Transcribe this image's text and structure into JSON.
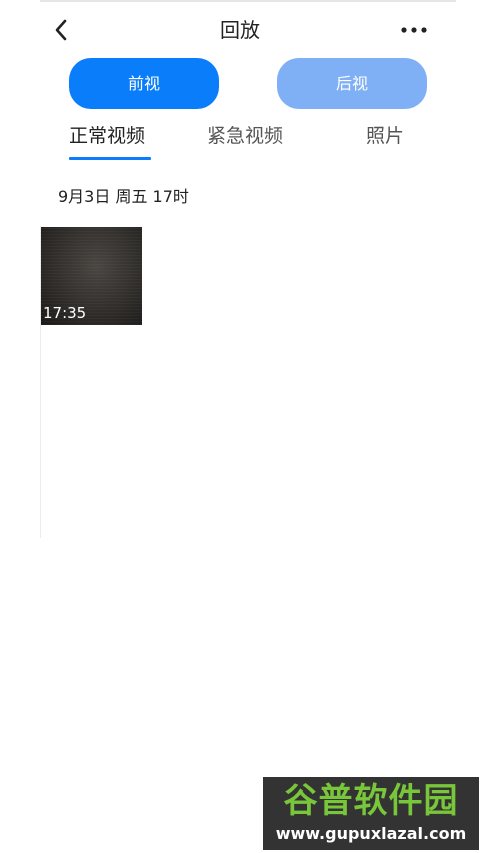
{
  "header": {
    "title": "回放",
    "back_icon": "chevron-left-icon",
    "more_icon": "more-horizontal-icon"
  },
  "camera_toggle": {
    "front_label": "前视",
    "rear_label": "后视",
    "selected": "front"
  },
  "tabs": [
    {
      "label": "正常视频",
      "active": true
    },
    {
      "label": "紧急视频",
      "active": false
    },
    {
      "label": "照片",
      "active": false
    }
  ],
  "recordings": {
    "group_label": "9月3日 周五 17时",
    "items": [
      {
        "time": "17:35"
      }
    ]
  },
  "watermark": {
    "logo_text": "谷普软件园",
    "url": "www.gupuxlazal.com"
  },
  "colors": {
    "accent": "#0a7dfa",
    "accent_light": "#7fb0f5",
    "watermark_green": "#78c63a"
  }
}
